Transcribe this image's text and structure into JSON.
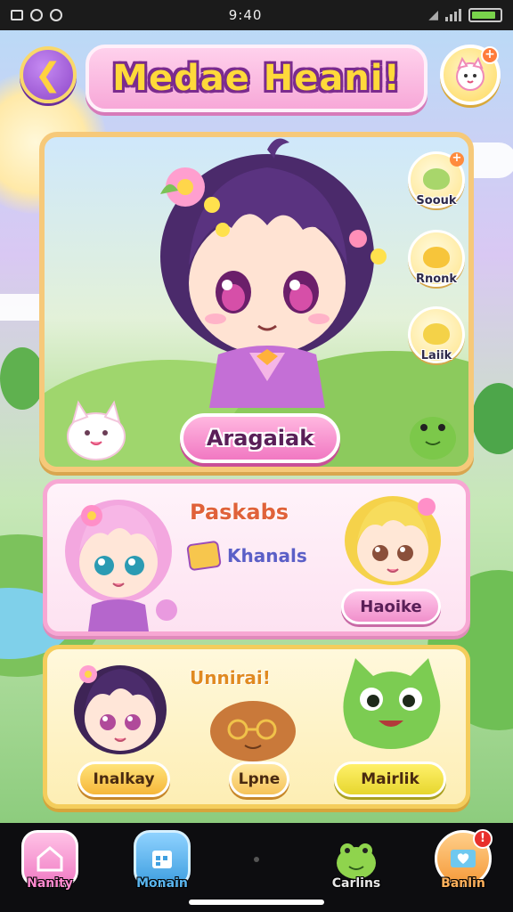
{
  "status_bar": {
    "time": "9:40"
  },
  "header": {
    "title": "Medae Heani!"
  },
  "main_card": {
    "action_label": "Aragaiak",
    "side_buttons": [
      {
        "label": "Soouk",
        "color": "#a8d66b"
      },
      {
        "label": "Rnonk",
        "color": "#f7c53a"
      },
      {
        "label": "Laiik",
        "color": "#f4d248"
      }
    ]
  },
  "card2": {
    "title": "Paskabs",
    "subtitle": "Khanals",
    "button_label": "Haoike"
  },
  "card3": {
    "title": "Unnirai!",
    "buttons": [
      "Inalkay",
      "Lpne",
      "Mairlik"
    ]
  },
  "bottom_nav": [
    {
      "label": "Nanity",
      "icon": "home-icon",
      "color": "#ff9ad0",
      "text_color": "#ff8ad0"
    },
    {
      "label": "Monain",
      "icon": "calendar-box-icon",
      "color": "#5cb8f0",
      "text_color": "#5ab6f0"
    },
    {
      "label": "Carlins",
      "icon": "frog-icon",
      "color": "#8fd44d",
      "text_color": "#e8e8e8"
    },
    {
      "label": "Banlin",
      "icon": "heart-mail-icon",
      "color": "#ffb15c",
      "text_color": "#ffb15c",
      "badge": "!"
    }
  ]
}
